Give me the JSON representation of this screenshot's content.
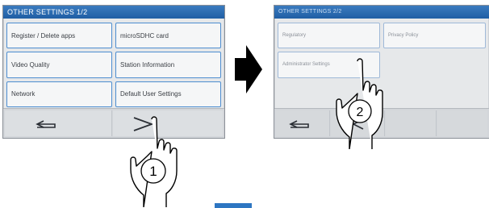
{
  "screen1": {
    "title": "OTHER SETTINGS 1/2",
    "buttons": [
      "Register / Delete apps",
      "microSDHC card",
      "Video Quality",
      "Station Information",
      "Network",
      "Default User Settings"
    ],
    "back_icon": "back-arrow-icon",
    "next_icon": "next-chevron-icon"
  },
  "screen2": {
    "title": "OTHER SETTINGS 2/2",
    "buttons": [
      "Regulatory",
      "Privacy Policy",
      "Administrator Settings"
    ],
    "back_icon": "back-arrow-icon",
    "prev_icon": "prev-chevron-icon"
  },
  "steps": {
    "step1": "1",
    "step2": "2"
  },
  "colors": {
    "titlebar": "#1f5ea4",
    "button_border": "#4d8dd0",
    "arrow": "#000000"
  }
}
